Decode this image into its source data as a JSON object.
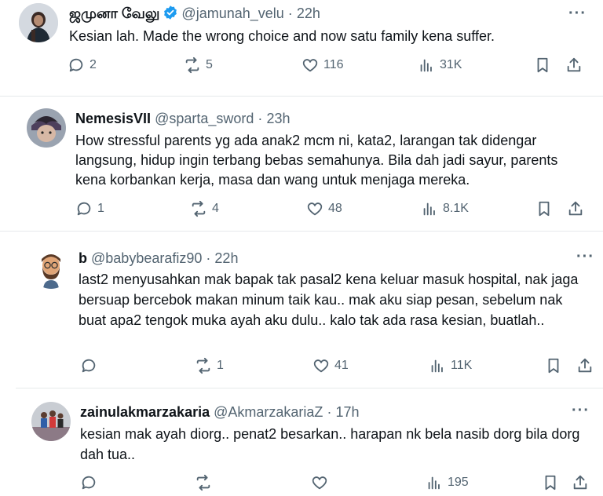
{
  "posts": [
    {
      "name": "ஜமுனா வேலு",
      "handle": "@jamunah_velu",
      "time": "22h",
      "verified": true,
      "body": "Kesian lah. Made the wrong choice and now satu family kena suffer.",
      "replies": "2",
      "reposts": "5",
      "likes": "116",
      "views": "31K"
    },
    {
      "name": "NemesisVII",
      "handle": "@sparta_sword",
      "time": "23h",
      "verified": false,
      "body": "How stressful parents yg ada anak2 mcm ni, kata2, larangan tak didengar langsung, hidup ingin terbang bebas semahunya. Bila dah jadi sayur, parents kena korbankan kerja, masa dan wang untuk menjaga mereka.",
      "replies": "1",
      "reposts": "4",
      "likes": "48",
      "views": "8.1K"
    },
    {
      "name": "b",
      "handle": "@babybearafiz90",
      "time": "22h",
      "verified": false,
      "body": "last2 menyusahkan mak bapak tak pasal2 kena keluar masuk hospital, nak jaga bersuap bercebok makan minum taik kau.. mak aku siap pesan, sebelum nak buat apa2 tengok muka ayah aku dulu.. kalo tak ada rasa kesian, buatlah..",
      "replies": "",
      "reposts": "1",
      "likes": "41",
      "views": "11K"
    },
    {
      "name": "zainulakmarzakaria",
      "handle": "@AkmarzakariaZ",
      "time": "17h",
      "verified": false,
      "body": "kesian mak ayah diorg.. penat2 besarkan.. harapan nk bela nasib dorg bila dorg dah tua..",
      "replies": "",
      "reposts": "",
      "likes": "",
      "views": "195"
    }
  ],
  "separator": "·",
  "colors": {
    "text": "#0f1419",
    "muted": "#536471",
    "verified": "#1d9bf0",
    "divider": "#e6e9eb"
  }
}
